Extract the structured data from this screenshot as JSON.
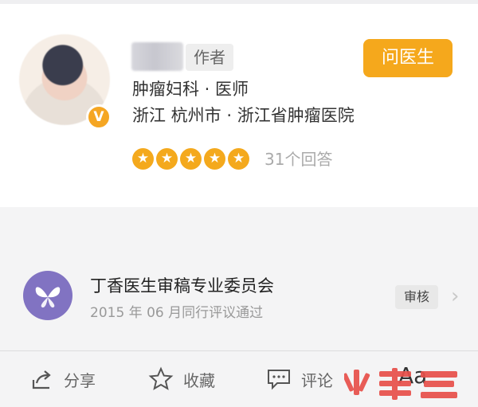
{
  "doctor": {
    "author_tag": "作者",
    "department_title": "肿瘤妇科 · 医师",
    "location_hospital": "浙江 杭州市 · 浙江省肿瘤医院",
    "verified_badge": "V",
    "rating_stars": 5,
    "answer_count": "31个回答",
    "ask_button": "问医生"
  },
  "review": {
    "committee_name": "丁香医生审稿专业委员会",
    "review_date": "2015 年 06 月同行评议通过",
    "badge": "审核",
    "chevron": "›"
  },
  "toolbar": {
    "share": "分享",
    "favorite": "收藏",
    "comment": "评论",
    "font_size": "Aa"
  },
  "colors": {
    "accent_orange": "#f5a81c",
    "star_orange": "#f4a91d",
    "committee_purple": "#8173c2",
    "watermark_red": "#e8504a"
  },
  "icons": [
    "share-icon",
    "star-icon",
    "comment-icon",
    "chevron-right-icon",
    "verified-icon"
  ]
}
